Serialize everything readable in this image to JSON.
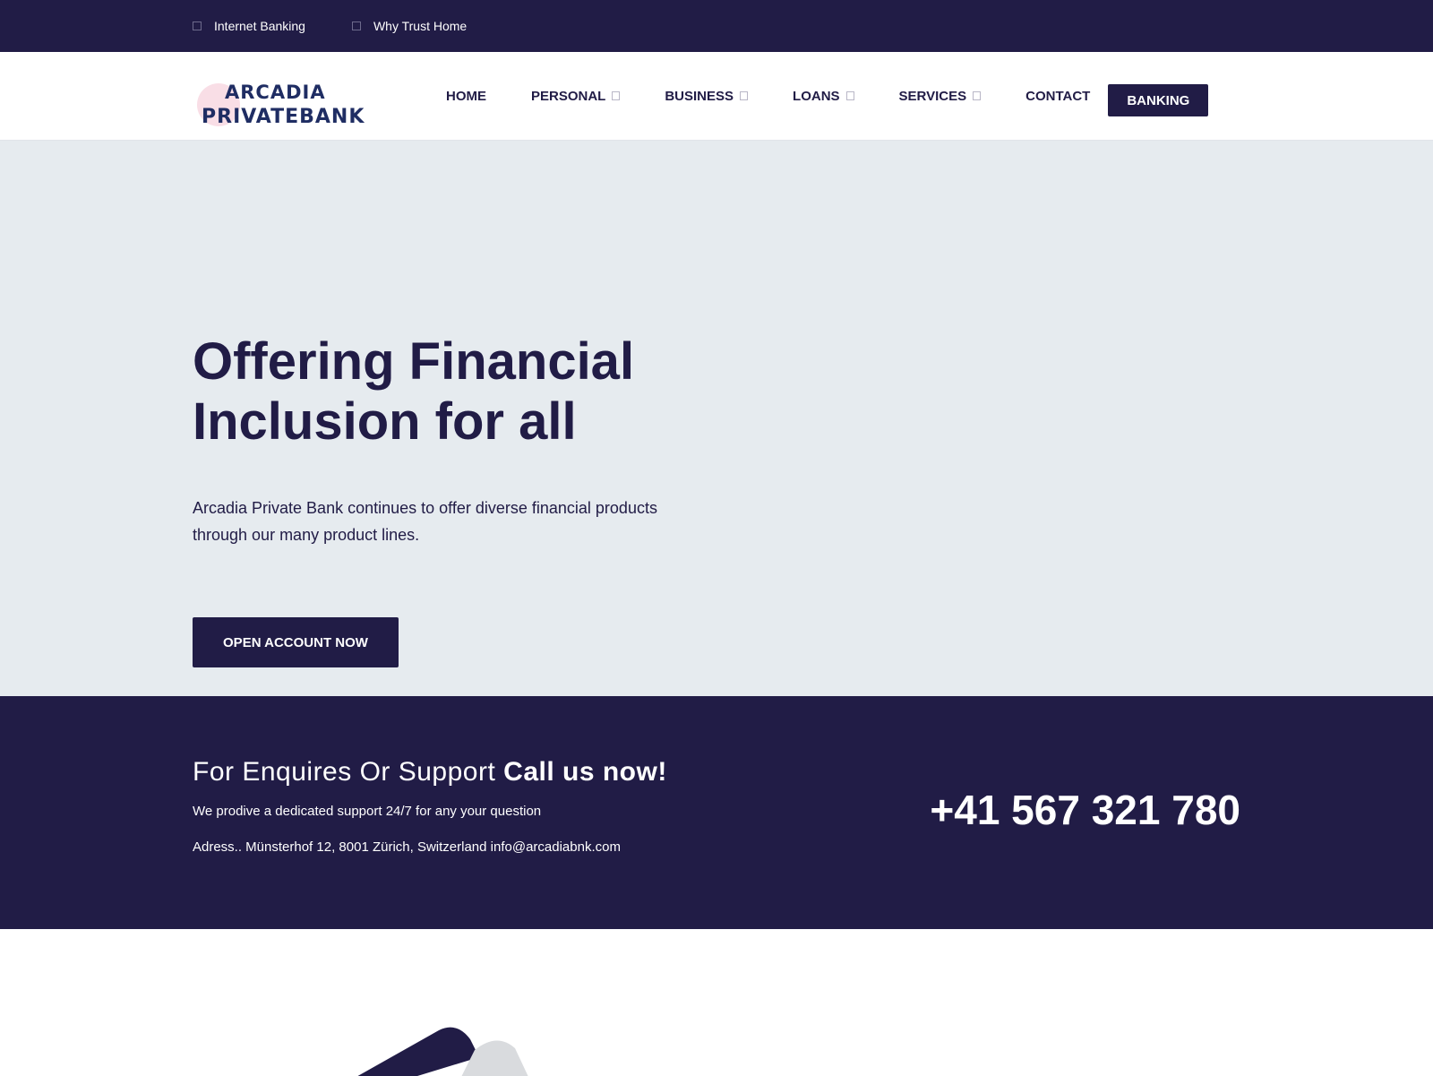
{
  "topbar": {
    "links": [
      {
        "label": "Internet Banking"
      },
      {
        "label": "Why Trust Home"
      }
    ]
  },
  "logo": {
    "line1": "ARCADIA",
    "line2": "PRIVATEBANK"
  },
  "nav": {
    "items": [
      {
        "label": "HOME"
      },
      {
        "label": "PERSONAL"
      },
      {
        "label": "BUSINESS"
      },
      {
        "label": "LOANS"
      },
      {
        "label": "SERVICES"
      },
      {
        "label": "CONTACT"
      }
    ],
    "banking_label": "BANKING"
  },
  "hero": {
    "title_line1": "Offering Financial",
    "title_line2": "Inclusion for all",
    "text_line1": "Arcadia Private Bank continues to offer diverse financial products",
    "text_line2": "through our many product lines.",
    "cta_label": "OPEN ACCOUNT NOW"
  },
  "contact": {
    "heading_light": "For Enquires Or Support",
    "heading_bold": "Call us now!",
    "subtext": "We prodive a dedicated support 24/7 for any your question",
    "address": "Adress.. Münsterhof 12, 8001 Zürich, Switzerland info@arcadiabnk.com",
    "phone": "+41 567 321 780"
  },
  "colors": {
    "primary": "#211c46",
    "hero_bg": "#e6ebef",
    "logo_blue": "#1f2d63",
    "logo_pink": "#f6d0dc"
  }
}
